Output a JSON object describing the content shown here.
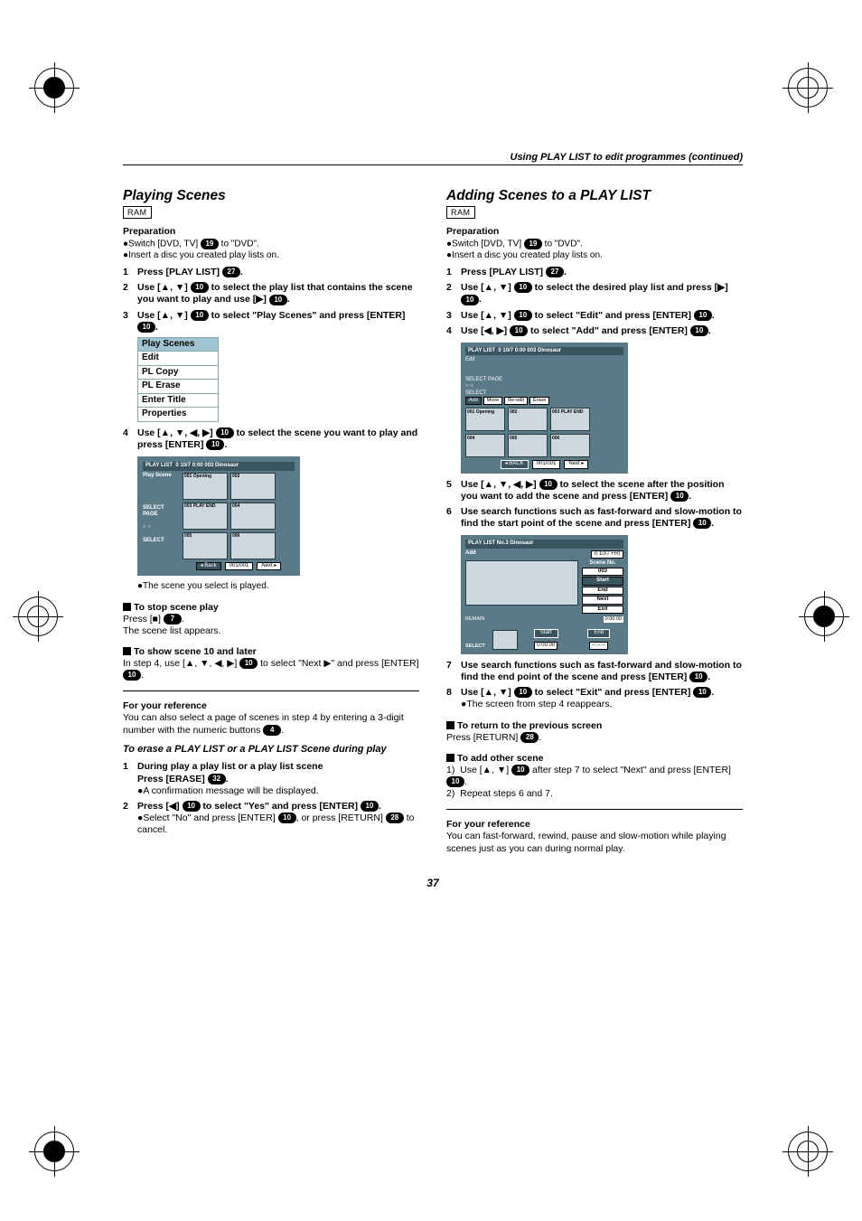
{
  "running_head": "Using PLAY LIST to edit programmes (continued)",
  "page_number": "37",
  "badges": {
    "b4": "4",
    "b7": "7",
    "b10": "10",
    "b19": "19",
    "b27": "27",
    "b28": "28",
    "b32": "32"
  },
  "common": {
    "ram": "RAM",
    "prep_label": "Preparation",
    "prep1_a": "Switch [DVD, TV] ",
    "prep1_b": " to \"DVD\".",
    "prep2": "Insert a disc you created play lists on."
  },
  "menu": {
    "items": [
      "Play Scenes",
      "Edit",
      "PL Copy",
      "PL Erase",
      "Enter Title",
      "Properties"
    ]
  },
  "osd_play": {
    "title_left": "PLAY LIST",
    "title_sub": "Play Scene",
    "title_right": "0 10/7 0:00 003  Dinosaur",
    "side1": "SELECT PAGE",
    "side2": "SELECT",
    "cells": [
      "001 Opening",
      "002",
      "003 PLAY END",
      "004",
      "005",
      "006"
    ],
    "btn_back": "◂ Back",
    "btn_page": "001/001",
    "btn_next": "Next ▸"
  },
  "osd_edit": {
    "title_left": "PLAY LIST",
    "title_sub": "Edit",
    "title_right": "0 10/7 0:00 003  Dinosaur",
    "tabs": [
      "Add",
      "Move",
      "Re-edit",
      "Erase"
    ],
    "cells": [
      "001 Opening",
      "002",
      "003 PLAY END",
      "004",
      "005",
      "006"
    ],
    "side1": "SELECT PAGE",
    "side2": "SELECT",
    "btn_back": "◂ BACK",
    "btn_page": "001/001",
    "btn_next": "Next ▸"
  },
  "osd_add": {
    "title": "PLAY LIST No.3 Dinosaur",
    "addlbl": "Add",
    "date": "0 10/7 FRI",
    "scene_no_lbl": "Scene No.",
    "scene_no": "003",
    "ctrl_start": "Start",
    "ctrl_end": "End",
    "ctrl_next": "Next",
    "ctrl_exit": "Exit",
    "remain_lbl": "REMAIN",
    "remain_val": "0:00:00",
    "select_lbl": "SELECT",
    "bottom_start": "Start",
    "bottom_start_t": "0:00:00",
    "bottom_end": "End",
    "bottom_end_t": "--:--:--"
  },
  "left": {
    "h1": "Playing Scenes",
    "s1": "Press [PLAY LIST] ",
    "s2a": "Use [▲, ▼] ",
    "s2b": " to select the play list that contains the scene you want to play and use [▶] ",
    "s3a": "Use [▲, ▼] ",
    "s3b": " to select \"Play Scenes\" and press [ENTER] ",
    "s4a": "Use [▲, ▼, ◀, ▶] ",
    "s4b": " to select the scene you want to play and press [ENTER] ",
    "note_played": "The scene you select is played.",
    "stop_head": "To stop scene play",
    "stop_a": "Press [■] ",
    "stop_b": "The scene list appears.",
    "ten_head": "To show scene 10 and later",
    "ten_a": "In step 4, use [▲, ▼, ◀, ▶] ",
    "ten_b": " to select \"Next ▶\" and press [ENTER] ",
    "ref_head": "For your reference",
    "ref_a": "You can also select a page of scenes in step 4 by entering a 3-digit number with the numeric buttons ",
    "erase_head": "To erase a PLAY LIST or a PLAY LIST Scene during play",
    "e1a": "During play a play list or a play list scene",
    "e1b": "Press [ERASE] ",
    "e1note": "A confirmation message will be displayed.",
    "e2a": "Press [◀] ",
    "e2b": " to select \"Yes\" and press [ENTER] ",
    "e2note_a": "Select \"No\" and press [ENTER] ",
    "e2note_b": ", or press [RETURN] ",
    "e2note_c": " to cancel."
  },
  "right": {
    "h1": "Adding Scenes to a PLAY LIST",
    "s1": "Press [PLAY LIST] ",
    "s2a": "Use [▲, ▼] ",
    "s2b": " to select the desired play list and press [▶] ",
    "s3a": "Use [▲, ▼] ",
    "s3b": " to select \"Edit\" and press [ENTER] ",
    "s4a": "Use [◀, ▶] ",
    "s4b": " to select \"Add\" and press [ENTER] ",
    "s5a": "Use [▲, ▼, ◀, ▶] ",
    "s5b": " to select the scene after the position you want to add the scene and press [ENTER] ",
    "s6a": "Use search functions such as fast-forward and slow-motion to find the start point of the scene and press [ENTER] ",
    "s7": "Use search functions such as fast-forward and slow-motion to find the end point of the scene and press [ENTER] ",
    "s8a": "Use [▲, ▼] ",
    "s8b": " to select \"Exit\" and press [ENTER] ",
    "s8note": "The screen from step 4 reappears.",
    "ret_head": "To return to the previous screen",
    "ret_a": "Press [RETURN] ",
    "add_head": "To add other scene",
    "add1a": "Use [▲, ▼] ",
    "add1b": " after step 7 to select \"Next\" and press [ENTER] ",
    "add2": "Repeat steps 6 and 7.",
    "ref_head": "For your reference",
    "ref_body": "You can fast-forward, rewind, pause and slow-motion while playing scenes just as you can during normal play."
  }
}
